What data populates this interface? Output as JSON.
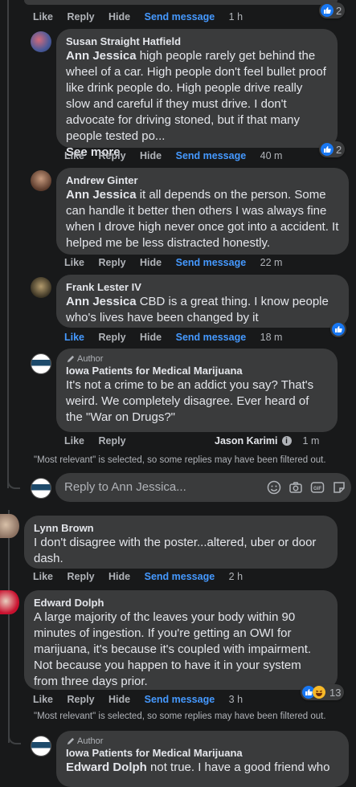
{
  "top_row": {
    "like": "Like",
    "reply": "Reply",
    "hide": "Hide",
    "send": "Send message",
    "time": "1 h",
    "react_count": "2"
  },
  "comments": [
    {
      "name": "Susan Straight Hatfield",
      "tag": "Ann Jessica",
      "text": " high people rarely get behind the wheel of a car. High people don't feel bullet proof like drink people do. High people drive really slow and careful if they must drive. I don't advocate for driving stoned, but if that many people tested po...",
      "see_more": "See more",
      "like": "Like",
      "reply": "Reply",
      "hide": "Hide",
      "send": "Send message",
      "time": "40 m",
      "react_count": "2"
    },
    {
      "name": "Andrew Ginter",
      "tag": "Ann Jessica",
      "text": " it all depends on the person. Some can handle it better then others I was always fine when I drove high never once got into a accident. It helped me be less distracted honestly.",
      "like": "Like",
      "reply": "Reply",
      "hide": "Hide",
      "send": "Send message",
      "time": "22 m"
    },
    {
      "name": "Frank Lester IV",
      "tag": "Ann Jessica",
      "text": " CBD is a great thing. I know people who's lives have been changed by it",
      "like": "Like",
      "reply": "Reply",
      "hide": "Hide",
      "send": "Send message",
      "time": "18 m"
    },
    {
      "author_label": "Author",
      "name": "Iowa Patients for Medical Marijuana",
      "text": "It's not a crime to be an addict you say? That's weird. We completely disagree. Ever heard of the \"War on Drugs?\"",
      "like": "Like",
      "reply": "Reply",
      "responder": "Jason Karimi",
      "time": "1 m"
    }
  ],
  "notice_1": "\"Most relevant\" is selected, so some replies may have been filtered out.",
  "reply_box": {
    "placeholder": "Reply to Ann Jessica..."
  },
  "lynn": {
    "name": "Lynn Brown",
    "text": "I don't disagree with the poster...altered, uber or door dash.",
    "like": "Like",
    "reply": "Reply",
    "hide": "Hide",
    "send": "Send message",
    "time": "2 h"
  },
  "edward": {
    "name": "Edward Dolph",
    "text": "A large majority of thc leaves your body within 90 minutes of ingestion. If you're getting an OWI for marijuana, it's because it's coupled with impairment. Not because you happen to have it in your system from three days prior.",
    "like": "Like",
    "reply": "Reply",
    "hide": "Hide",
    "send": "Send message",
    "time": "3 h",
    "react_count": "13"
  },
  "notice_2": "\"Most relevant\" is selected, so some replies may have been filtered out.",
  "bottom": {
    "author_label": "Author",
    "name": "Iowa Patients for Medical Marijuana",
    "tag": "Edward Dolph",
    "text": " not true. I have a good friend who"
  },
  "colors": {
    "bg": "#18191a",
    "bubble": "#3a3b3c",
    "link": "#4599ff",
    "muted": "#b0b3b8",
    "like": "#1877f2"
  }
}
